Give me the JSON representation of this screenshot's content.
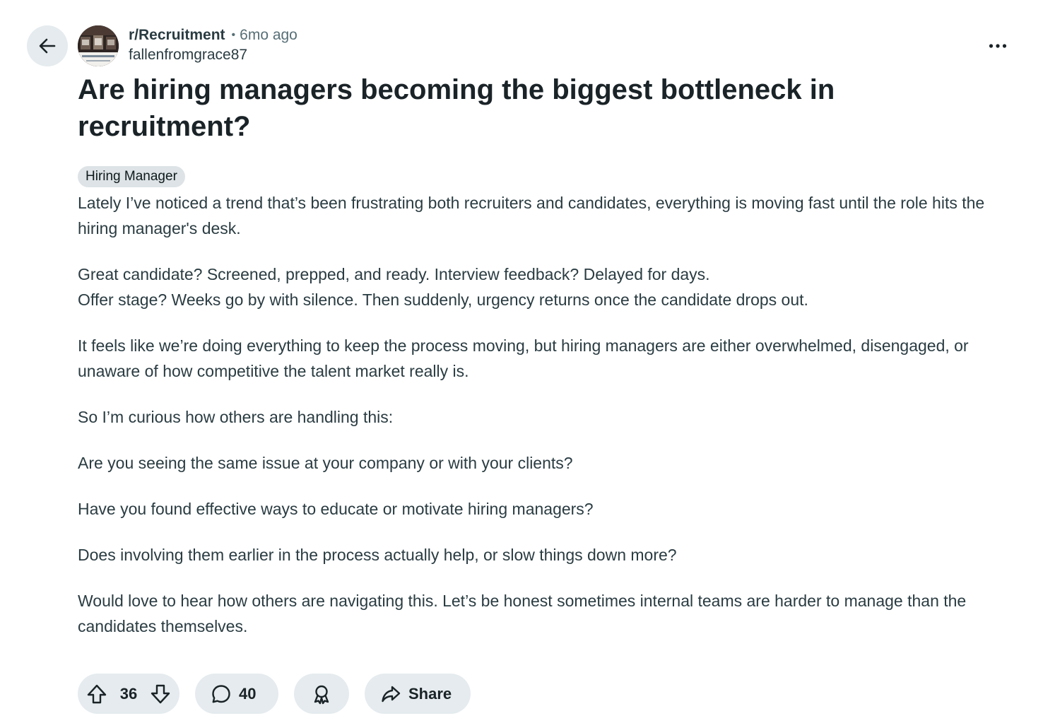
{
  "post": {
    "subreddit": "r/Recruitment",
    "separator": "•",
    "time": "6mo ago",
    "author": "fallenfromgrace87",
    "title": "Are hiring managers becoming the biggest bottleneck in recruitment?",
    "flair": "Hiring Manager",
    "body": [
      "Lately I’ve noticed a trend that’s been frustrating both recruiters and candidates, everything is moving fast until the role hits the hiring manager's desk.",
      "Great candidate? Screened, prepped, and ready. Interview feedback? Delayed for days.",
      "Offer stage? Weeks go by with silence. Then suddenly, urgency returns once the candidate drops out.",
      "It feels like we’re doing everything to keep the process moving, but hiring managers are either overwhelmed, disengaged, or unaware of how competitive the talent market really is.",
      "So I’m curious how others are handling this:",
      "Are you seeing the same issue at your company or with your clients?",
      "Have you found effective ways to educate or motivate hiring managers?",
      "Does involving them earlier in the process actually help, or slow things down more?",
      "Would love to hear how others are navigating this. Let’s be honest sometimes internal teams are harder to manage than the candidates themselves."
    ]
  },
  "actions": {
    "vote_count": "36",
    "comment_count": "40",
    "share_label": "Share"
  },
  "icons": {
    "back": "arrow-left-icon",
    "more": "more-horizontal-icon",
    "upvote": "upvote-arrow-icon",
    "downvote": "downvote-arrow-icon",
    "comment": "comment-bubble-icon",
    "award": "award-icon",
    "share": "share-arrow-icon"
  },
  "colors": {
    "pill_background": "#e5ebee",
    "flair_background": "#dde3e6",
    "text_primary": "#1a2327",
    "text_body": "#2a3c42",
    "text_muted": "#576f76"
  }
}
